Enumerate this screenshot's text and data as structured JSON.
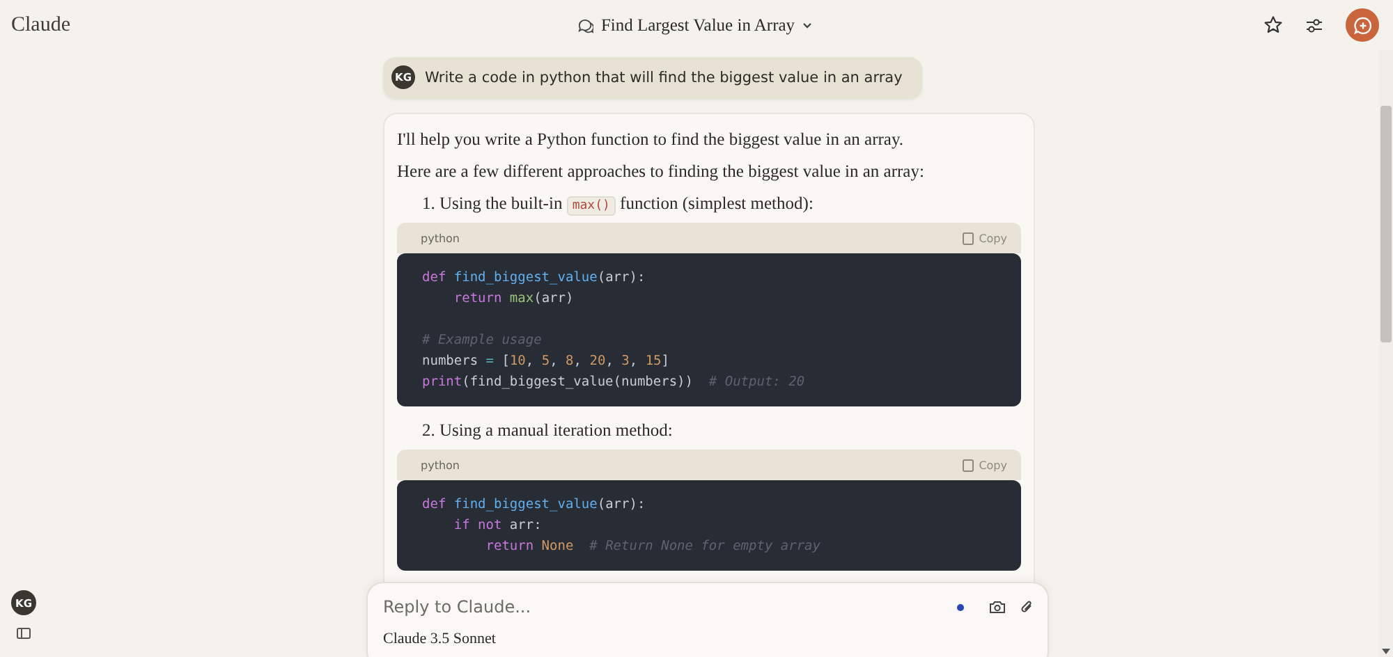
{
  "app": {
    "logo": "Claude"
  },
  "header": {
    "title": "Find Largest Value in Array"
  },
  "user_message": {
    "initials": "KG",
    "text": "Write a code in python that will find the biggest value in an array"
  },
  "response": {
    "paragraphs": [
      "I'll help you write a Python function to find the biggest value in an array.",
      "Here are a few different approaches to finding the biggest value in an array:"
    ],
    "sections": [
      {
        "number": "1.",
        "parts": [
          {
            "kind": "text",
            "text": "Using the built-in "
          },
          {
            "kind": "code",
            "text": "max()"
          },
          {
            "kind": "text",
            "text": " function (simplest method):"
          }
        ],
        "code": {
          "language": "python",
          "copy_label": "Copy",
          "lines": [
            {
              "gap_before": false,
              "tokens": [
                {
                  "kind": "kw",
                  "text": "def "
                },
                {
                  "kind": "fn",
                  "text": "find_biggest_value"
                },
                {
                  "kind": "plain",
                  "text": "(arr):"
                }
              ]
            },
            {
              "gap_before": false,
              "tokens": [
                {
                  "kind": "kw",
                  "text": "    return "
                },
                {
                  "kind": "builtin",
                  "text": "max"
                },
                {
                  "kind": "plain",
                  "text": "(arr)"
                }
              ]
            },
            {
              "gap_before": true,
              "tokens": [
                {
                  "kind": "comment",
                  "text": "# Example usage"
                }
              ]
            },
            {
              "gap_before": false,
              "tokens": [
                {
                  "kind": "plain",
                  "text": "numbers "
                },
                {
                  "kind": "op",
                  "text": "="
                },
                {
                  "kind": "plain",
                  "text": " ["
                },
                {
                  "kind": "num",
                  "text": "10"
                },
                {
                  "kind": "plain",
                  "text": ", "
                },
                {
                  "kind": "num",
                  "text": "5"
                },
                {
                  "kind": "plain",
                  "text": ", "
                },
                {
                  "kind": "num",
                  "text": "8"
                },
                {
                  "kind": "plain",
                  "text": ", "
                },
                {
                  "kind": "num",
                  "text": "20"
                },
                {
                  "kind": "plain",
                  "text": ", "
                },
                {
                  "kind": "num",
                  "text": "3"
                },
                {
                  "kind": "plain",
                  "text": ", "
                },
                {
                  "kind": "num",
                  "text": "15"
                },
                {
                  "kind": "plain",
                  "text": "]"
                }
              ]
            },
            {
              "gap_before": false,
              "tokens": [
                {
                  "kind": "kw",
                  "text": "print"
                },
                {
                  "kind": "plain",
                  "text": "(find_biggest_value(numbers))  "
                },
                {
                  "kind": "comment",
                  "text": "# Output: 20"
                }
              ]
            }
          ]
        }
      },
      {
        "number": "2.",
        "parts": [
          {
            "kind": "text",
            "text": "Using a manual iteration method:"
          }
        ],
        "code": {
          "language": "python",
          "copy_label": "Copy",
          "lines": [
            {
              "gap_before": false,
              "tokens": [
                {
                  "kind": "kw",
                  "text": "def "
                },
                {
                  "kind": "fn",
                  "text": "find_biggest_value"
                },
                {
                  "kind": "plain",
                  "text": "(arr):"
                }
              ]
            },
            {
              "gap_before": false,
              "tokens": [
                {
                  "kind": "kw",
                  "text": "    if not "
                },
                {
                  "kind": "plain",
                  "text": "arr:"
                }
              ]
            },
            {
              "gap_before": false,
              "tokens": [
                {
                  "kind": "kw",
                  "text": "        return "
                },
                {
                  "kind": "const",
                  "text": "None  "
                },
                {
                  "kind": "comment",
                  "text": "# Return None for empty array"
                }
              ]
            }
          ]
        }
      }
    ]
  },
  "composer": {
    "placeholder": "Reply to Claude...",
    "model": "Claude 3.5 Sonnet"
  },
  "sidebar": {
    "initials": "KG"
  }
}
